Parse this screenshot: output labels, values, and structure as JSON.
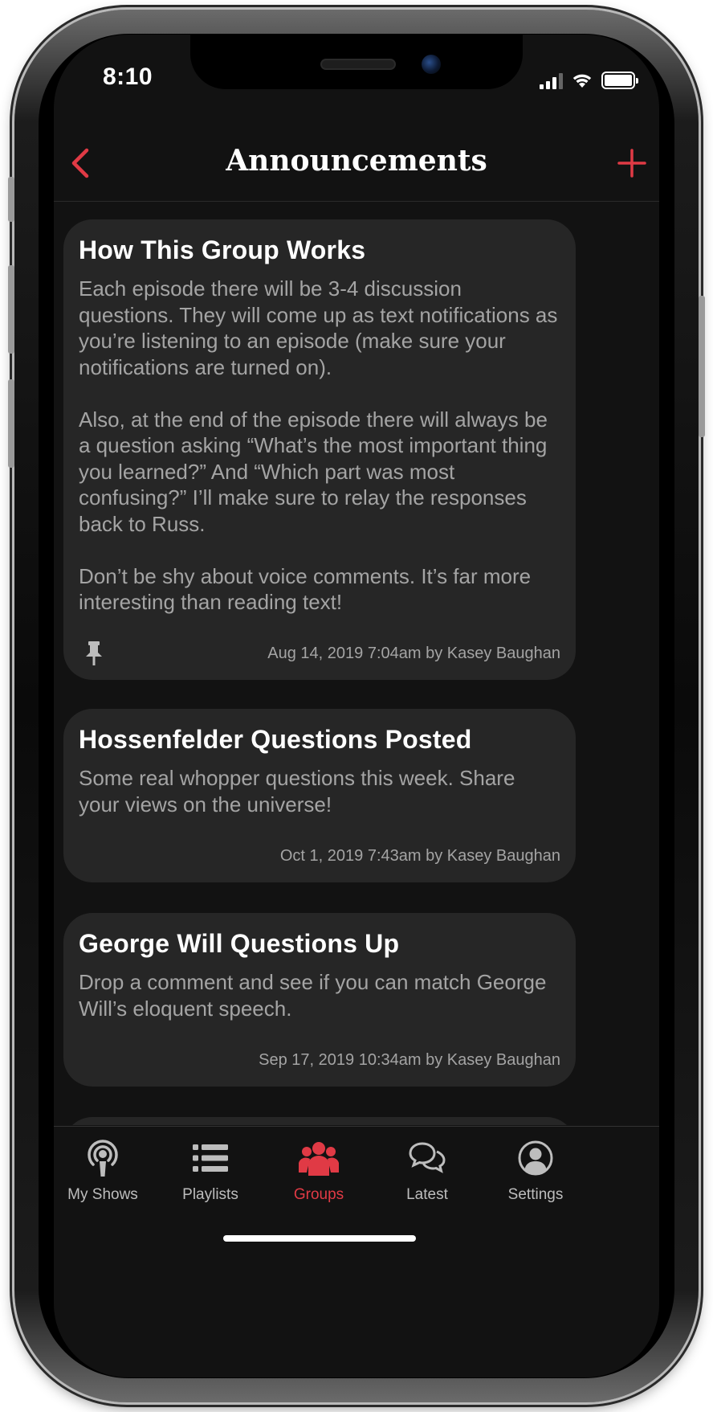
{
  "status_bar": {
    "time": "8:10"
  },
  "nav": {
    "title": "Announcements",
    "back_icon": "chevron-left-icon",
    "add_icon": "plus-icon",
    "accent_color": "#e03a45"
  },
  "announcements": [
    {
      "title": "How This Group Works",
      "body": "Each episode there will be 3-4 discussion questions. They will come up as text notifications as you’re listening to an episode (make sure your notifications are turned on).\n\nAlso, at the end of the episode there will always be a question asking “What’s the most important thing you learned?” And “Which part was most confusing?” I’ll make sure to relay the responses back to Russ.\n\nDon’t be shy about voice comments. It’s far more interesting than reading text!",
      "meta": "Aug 14, 2019 7:04am by Kasey Baughan",
      "pinned": true
    },
    {
      "title": "Hossenfelder Questions Posted",
      "body": "Some real whopper questions this week. Share your views on the universe!",
      "meta": "Oct 1, 2019 7:43am by Kasey Baughan",
      "pinned": false
    },
    {
      "title": "George Will Questions Up",
      "body": "Drop a comment and see if you can match George Will’s eloquent speech.",
      "meta": "Sep 17, 2019 10:34am by Kasey Baughan",
      "pinned": false
    }
  ],
  "tabs": [
    {
      "label": "My Shows",
      "icon": "podcast-icon",
      "active": false
    },
    {
      "label": "Playlists",
      "icon": "list-icon",
      "active": false
    },
    {
      "label": "Groups",
      "icon": "group-icon",
      "active": true
    },
    {
      "label": "Latest",
      "icon": "chat-bubbles-icon",
      "active": false
    },
    {
      "label": "Settings",
      "icon": "user-circle-icon",
      "active": false
    }
  ]
}
